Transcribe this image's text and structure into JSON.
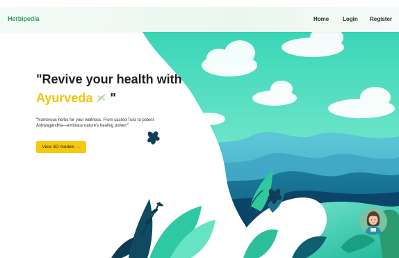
{
  "navbar": {
    "brand": "Herbipedia",
    "links": [
      {
        "label": "Home"
      },
      {
        "label": "Login"
      },
      {
        "label": "Register"
      }
    ]
  },
  "hero": {
    "title_line1": "\"Revive your health with",
    "title_accent": "Ayurveda",
    "title_end": "\"",
    "description": "\"Numerous herbs for your wellness. From sacred Tulsi to potent Ashwagandha—embrace nature's healing power!\"",
    "cta_label": "View 3D models →"
  },
  "icons": {
    "title_decoration": "leaf-icon",
    "assistant": "avatar-assistant-icon"
  },
  "colors": {
    "brand": "#2e9e5b",
    "accent": "#f5c20b",
    "cta_background": "#f6c90e",
    "teal_light": "#5fe0c4",
    "teal_dark": "#0c6f7a"
  }
}
